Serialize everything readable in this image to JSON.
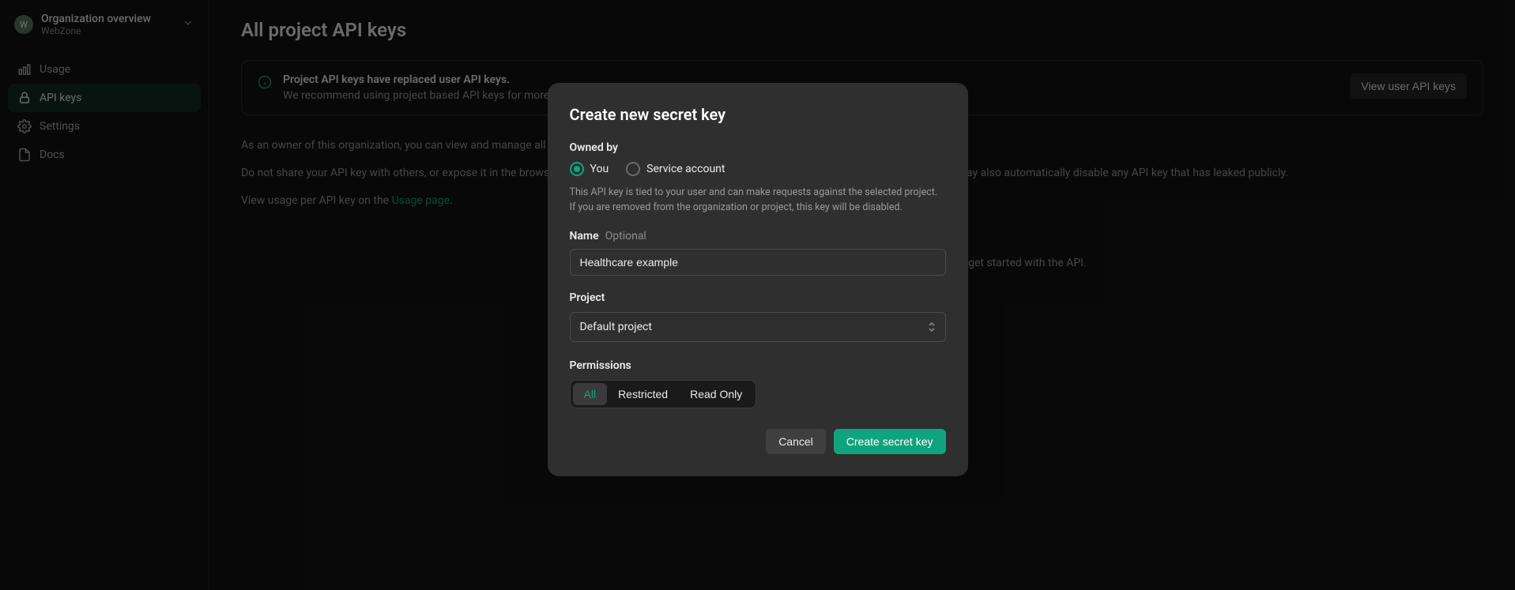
{
  "sidebar": {
    "org_avatar_letter": "W",
    "org_title": "Organization overview",
    "org_name": "WebZone",
    "items": [
      {
        "label": "Usage",
        "icon": "chart"
      },
      {
        "label": "API keys",
        "icon": "lock"
      },
      {
        "label": "Settings",
        "icon": "gear"
      },
      {
        "label": "Docs",
        "icon": "doc"
      }
    ],
    "active_index": 1
  },
  "main": {
    "title": "All project API keys",
    "banner": {
      "title": "Project API keys have replaced user API keys.",
      "text": "We recommend using project based API keys for more granular control over your resources.",
      "button": "View user API keys"
    },
    "paragraph1": "As an owner of this organization, you can view and manage all API keys in this organization.",
    "paragraph2": "Do not share your API key with others, or expose it in the browser or other client-side code. In order to protect the security of your account, OpenAI may also automatically disable any API key that has leaked publicly.",
    "paragraph3_prefix": "View usage per API key on the ",
    "paragraph3_link": "Usage page",
    "empty_message": "You currently do not have any API keys. Please create one below to get started with the API."
  },
  "modal": {
    "title": "Create new secret key",
    "owned_by_label": "Owned by",
    "owner_options": [
      "You",
      "Service account"
    ],
    "owner_selected": 0,
    "owner_help": "This API key is tied to your user and can make requests against the selected project. If you are removed from the organization or project, this key will be disabled.",
    "name_label": "Name",
    "name_optional": "Optional",
    "name_value": "Healthcare example",
    "project_label": "Project",
    "project_value": "Default project",
    "permissions_label": "Permissions",
    "permission_options": [
      "All",
      "Restricted",
      "Read Only"
    ],
    "permission_selected": 0,
    "cancel": "Cancel",
    "submit": "Create secret key"
  }
}
